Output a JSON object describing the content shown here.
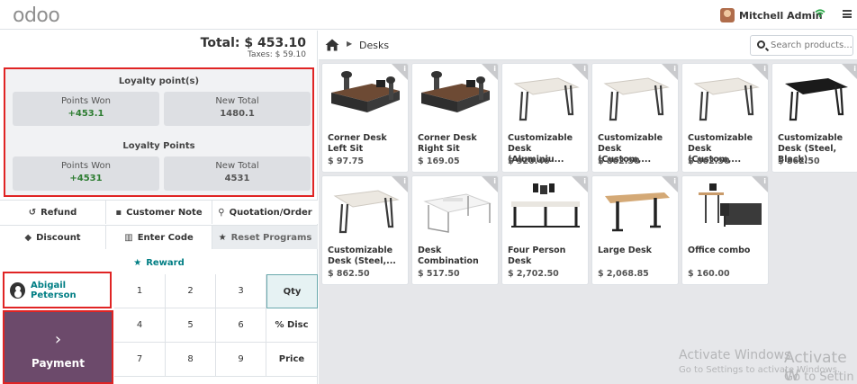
{
  "topbar": {
    "logo": "odoo",
    "user_name": "Mitchell Admin"
  },
  "order": {
    "total": "Total: $ 453.10",
    "taxes": "Taxes: $ 59.10"
  },
  "loyalty": {
    "section1_title": "Loyalty point(s)",
    "section1": {
      "won_label": "Points Won",
      "won_value": "+453.1",
      "total_label": "New Total",
      "total_value": "1480.1"
    },
    "section2_title": "Loyalty Points",
    "section2": {
      "won_label": "Points Won",
      "won_value": "+4531",
      "total_label": "New Total",
      "total_value": "4531"
    }
  },
  "controls": {
    "refund": "Refund",
    "customer_note": "Customer Note",
    "quotation": "Quotation/Order",
    "discount": "Discount",
    "enter_code": "Enter Code",
    "reset_programs": "Reset Programs",
    "reward": "Reward"
  },
  "customer": {
    "name": "Abigail Peterson"
  },
  "payment": {
    "label": "Payment",
    "arrow": "›"
  },
  "numpad": {
    "keys": [
      "1",
      "2",
      "3",
      "Qty",
      "4",
      "5",
      "6",
      "% Disc",
      "7",
      "8",
      "9",
      "Price"
    ]
  },
  "products_header": {
    "breadcrumb": "Desks",
    "search_placeholder": "Search products..."
  },
  "products": [
    {
      "name": "Corner Desk Left Sit",
      "price": "$ 97.75",
      "img": "corner-desk"
    },
    {
      "name": "Corner Desk Right Sit",
      "price": "$ 169.05",
      "img": "corner-desk"
    },
    {
      "name": "Customizable Desk (Aluminiu...",
      "price": "$ 920.46",
      "img": "white-desk"
    },
    {
      "name": "Customizable Desk (Custom,...",
      "price": "$ 862.50",
      "img": "white-desk"
    },
    {
      "name": "Customizable Desk (Custom,...",
      "price": "$ 862.50",
      "img": "white-desk"
    },
    {
      "name": "Customizable Desk (Steel, Black)",
      "price": "$ 862.50",
      "img": "black-desk"
    },
    {
      "name": "Customizable Desk (Steel,...",
      "price": "$ 862.50",
      "img": "white-desk"
    },
    {
      "name": "Desk Combination",
      "price": "$ 517.50",
      "img": "combo-desk"
    },
    {
      "name": "Four Person Desk",
      "price": "$ 2,702.50",
      "img": "four-desk"
    },
    {
      "name": "Large Desk",
      "price": "$ 2,068.85",
      "img": "large-desk"
    },
    {
      "name": "Office combo",
      "price": "$ 160.00",
      "img": "office-combo"
    }
  ],
  "watermark": {
    "line1": "Activate Windows",
    "line2": "Go to Settings to activate Windows.",
    "line1_repeat": "Activate W",
    "line2_repeat": "Go to Settin"
  },
  "colors": {
    "accent": "#017e84",
    "payment": "#6c4a6b",
    "highlight": "#e02424",
    "points": "#2e7d32"
  }
}
